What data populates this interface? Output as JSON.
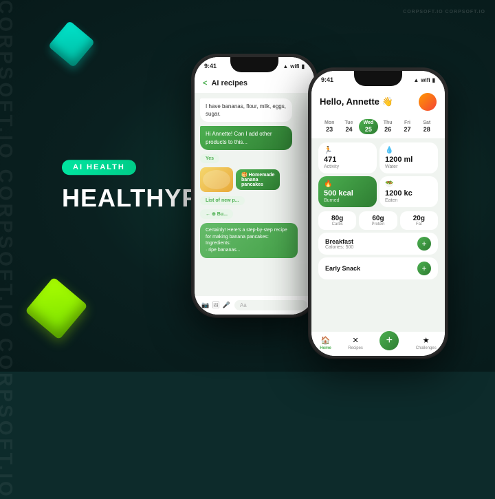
{
  "app": {
    "title": "HEALTHYFIT",
    "badge": "AI HEALTH",
    "watermark": "CORPSOFT.IO CORPSOFT.IO",
    "side_text": "CORPSOFT.IO CORPSOFT.IO CORPSOFT.IO"
  },
  "left_phone": {
    "status_time": "9:41",
    "header_back": "<",
    "header_title": "AI recipes",
    "chat": [
      {
        "type": "user",
        "text": "I have bananas, flour, milk, eggs, sugar."
      },
      {
        "type": "bot",
        "text": "Hi Annette! Can I add other products to this..."
      },
      {
        "type": "btn",
        "text": "Yes"
      },
      {
        "type": "label",
        "text": "🥞 Homemade banana pancakes"
      },
      {
        "type": "btn2",
        "text": "List of new p..."
      },
      {
        "type": "btn3",
        "text": "← ⊕ Bu..."
      },
      {
        "type": "recipe",
        "text": "Certainly! Here's a step-by-step recipe for making banana pancakes:\nIngredients:\n· ripe bananas..."
      }
    ],
    "input_placeholder": "Aa"
  },
  "right_phone": {
    "status_time": "9:41",
    "greeting": "Hello, Annette 👋",
    "week": [
      {
        "day": "Mon",
        "num": "23"
      },
      {
        "day": "Tue",
        "num": "24"
      },
      {
        "day": "Wed",
        "num": "25",
        "active": true
      },
      {
        "day": "Thu",
        "num": "26"
      },
      {
        "day": "Fri",
        "num": "27"
      },
      {
        "day": "Sat",
        "num": "28"
      }
    ],
    "stats": [
      {
        "icon": "🏃",
        "value": "471",
        "label": "Activity"
      },
      {
        "icon": "💧",
        "value": "1200 ml",
        "label": "Water"
      },
      {
        "icon": "🔥",
        "value": "500 kcal",
        "label": "Burned"
      },
      {
        "icon": "🥗",
        "value": "1200 kc",
        "label": "Eaten"
      }
    ],
    "macros": [
      {
        "value": "80g",
        "label": "Carbs"
      },
      {
        "value": "60g",
        "label": "Protein"
      },
      {
        "value": "20g",
        "label": "Fat"
      }
    ],
    "meals": [
      {
        "name": "Breakfast",
        "calories": "Calories: 500"
      },
      {
        "name": "Early Snack",
        "calories": ""
      }
    ],
    "nav": [
      {
        "icon": "🏠",
        "label": "Home",
        "active": true
      },
      {
        "icon": "✕",
        "label": "Recipes"
      },
      {
        "icon": "★",
        "label": "Challenges"
      }
    ]
  }
}
